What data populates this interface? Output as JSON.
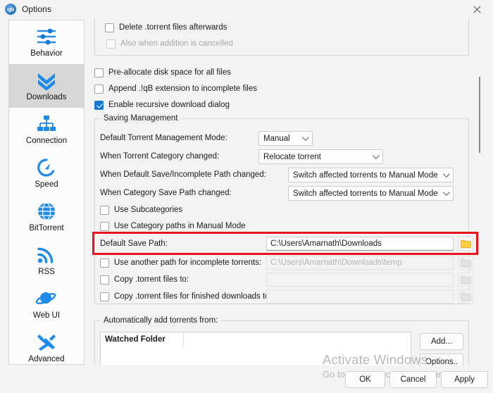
{
  "window": {
    "title": "Options",
    "app_icon_text": "qb",
    "close_icon": "close-icon"
  },
  "sidebar": {
    "items": [
      {
        "label": "Behavior",
        "icon": "sliders-icon",
        "selected": false
      },
      {
        "label": "Downloads",
        "icon": "double-chevron-down-icon",
        "selected": true
      },
      {
        "label": "Connection",
        "icon": "network-icon",
        "selected": false
      },
      {
        "label": "Speed",
        "icon": "speedometer-icon",
        "selected": false
      },
      {
        "label": "BitTorrent",
        "icon": "globe-icon",
        "selected": false
      },
      {
        "label": "RSS",
        "icon": "rss-icon",
        "selected": false
      },
      {
        "label": "Web UI",
        "icon": "planet-icon",
        "selected": false
      },
      {
        "label": "Advanced",
        "icon": "tools-icon",
        "selected": false
      }
    ]
  },
  "top_group": {
    "checkboxes": [
      {
        "label": "Delete .torrent files afterwards",
        "checked": false,
        "disabled": false
      },
      {
        "label": "Also when addition is cancelled",
        "checked": false,
        "disabled": true
      }
    ]
  },
  "standalone_checkboxes": [
    {
      "label": "Pre-allocate disk space for all files",
      "checked": false
    },
    {
      "label": "Append .!qB extension to incomplete files",
      "checked": false
    },
    {
      "label": "Enable recursive download dialog",
      "checked": true
    }
  ],
  "saving_management": {
    "title": "Saving Management",
    "rows": [
      {
        "label": "Default Torrent Management Mode:",
        "value": "Manual"
      },
      {
        "label": "When Torrent Category changed:",
        "value": "Relocate torrent"
      },
      {
        "label": "When Default Save/Incomplete Path changed:",
        "value": "Switch affected torrents to Manual Mode"
      },
      {
        "label": "When Category Save Path changed:",
        "value": "Switch affected torrents to Manual Mode"
      }
    ],
    "checkboxes": [
      {
        "label": "Use Subcategories",
        "checked": false
      },
      {
        "label": "Use Category paths in Manual Mode",
        "checked": false
      }
    ],
    "default_save_path": {
      "label": "Default Save Path:",
      "value": "C:\\Users\\Amarnath\\Downloads",
      "browse_icon": "folder-icon",
      "highlighted": true
    },
    "path_rows": [
      {
        "label": "Use another path for incomplete torrents:",
        "checked": false,
        "value": "C:\\Users\\Amarnath\\Downloads\\temp",
        "disabled": true
      },
      {
        "label": "Copy .torrent files to:",
        "checked": false,
        "value": "",
        "disabled": true
      },
      {
        "label": "Copy .torrent files for finished downloads to:",
        "checked": false,
        "value": "",
        "disabled": true
      }
    ]
  },
  "auto_add": {
    "title": "Automatically add torrents from:",
    "table": {
      "columns": [
        "Watched Folder"
      ],
      "rows": []
    },
    "buttons": {
      "add": "Add...",
      "options": "Options.."
    }
  },
  "dialog_buttons": {
    "ok": "OK",
    "cancel": "Cancel",
    "apply": "Apply"
  },
  "watermark": {
    "line1": "Activate Windows",
    "line2": "Go to Settings to activate Windows."
  },
  "colors": {
    "accent_blue": "#1778d0",
    "highlight_red": "#e8161c",
    "folder_yellow": "#ffcc44",
    "selected_bg": "#d7d7d7"
  }
}
